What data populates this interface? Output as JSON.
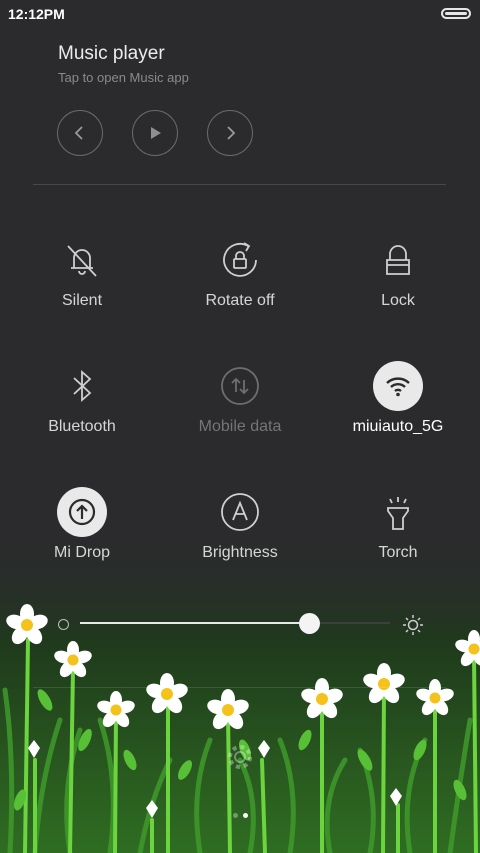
{
  "status": {
    "time": "12:12PM"
  },
  "music": {
    "title": "Music player",
    "subtitle": "Tap to open Music app"
  },
  "tiles": {
    "silent": "Silent",
    "rotate": "Rotate off",
    "lock": "Lock",
    "bluetooth": "Bluetooth",
    "mobile_data": "Mobile data",
    "wifi": "miuiauto_5G",
    "midrop": "Mi Drop",
    "brightness": "Brightness",
    "torch": "Torch"
  },
  "brightness_level": 0.74,
  "colors": {
    "background": "#2b2b2d",
    "grass": "#5cc63a",
    "petal": "#ffffff",
    "flower_center": "#f5c21b"
  }
}
